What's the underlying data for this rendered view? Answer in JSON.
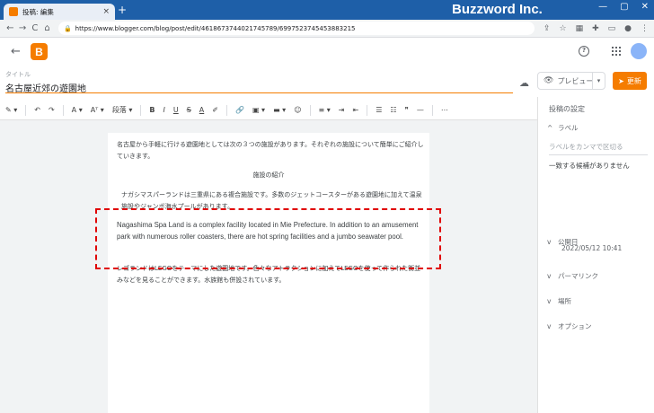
{
  "browser": {
    "tab_title": "投稿: 編集",
    "tab_close": "×",
    "new_tab": "+",
    "brand": "Buzzword Inc.",
    "url": "https://www.blogger.com/blog/post/edit/4618673744021745789/6997523745453883215",
    "nav": {
      "back": "←",
      "forward": "→",
      "reload": "C",
      "home": "⌂"
    }
  },
  "header": {
    "back": "←",
    "logo_letter": "B",
    "help": "?"
  },
  "post": {
    "title_label": "タイトル",
    "title": "名古屋近郊の遊園地",
    "preview": "プレビュー",
    "update": "更新"
  },
  "editor_toolbar": {
    "items": [
      "✎ ▾",
      "↶",
      "↷",
      "A ▾",
      "Aᵀ ▾",
      "段落 ▾",
      "B",
      "I",
      "U",
      "S",
      "A",
      "✐",
      "🔗",
      "▣ ▾",
      "▬ ▾",
      "☺",
      "≡ ▾",
      "⇥",
      "⇤",
      "☰",
      "☷",
      "❞",
      "—",
      "⋯"
    ]
  },
  "content": {
    "p1": "名古屋から手軽に行ける遊園地としては次の３つの施設があります。それぞれの施設について簡単にご紹介していきます。",
    "heading": "施設の紹介",
    "p2": "ナガシマスパーランドは三重県にある複合施設です。多数のジェットコースターがある遊園地に加えて温泉施設やジャンボ海水プールがあります。",
    "p3": "Nagashima Spa Land is a complex facility located in Mie Prefecture. In addition to an amusement park with numerous roller coasters, there are hot spring facilities and a jumbo seawater pool.",
    "p4": "レゴランドはLEGOをテーマにした遊園地です。色々なアトラクションに加えてLEGOを使って作られた街並みなどを見ることができます。水族館も併設されています。"
  },
  "sidebar": {
    "post_settings": "投稿の設定",
    "labels": "ラベル",
    "labels_placeholder": "ラベルをカンマで区切る",
    "no_match": "一致する候補がありません",
    "published": "公開日",
    "published_date": "2022/05/12 10:41",
    "permalink": "パーマリンク",
    "location": "場所",
    "options": "オプション"
  },
  "colors": {
    "accent": "#f57c00",
    "chrome": "#1e5fa8",
    "highlight_box": "#e00000"
  }
}
